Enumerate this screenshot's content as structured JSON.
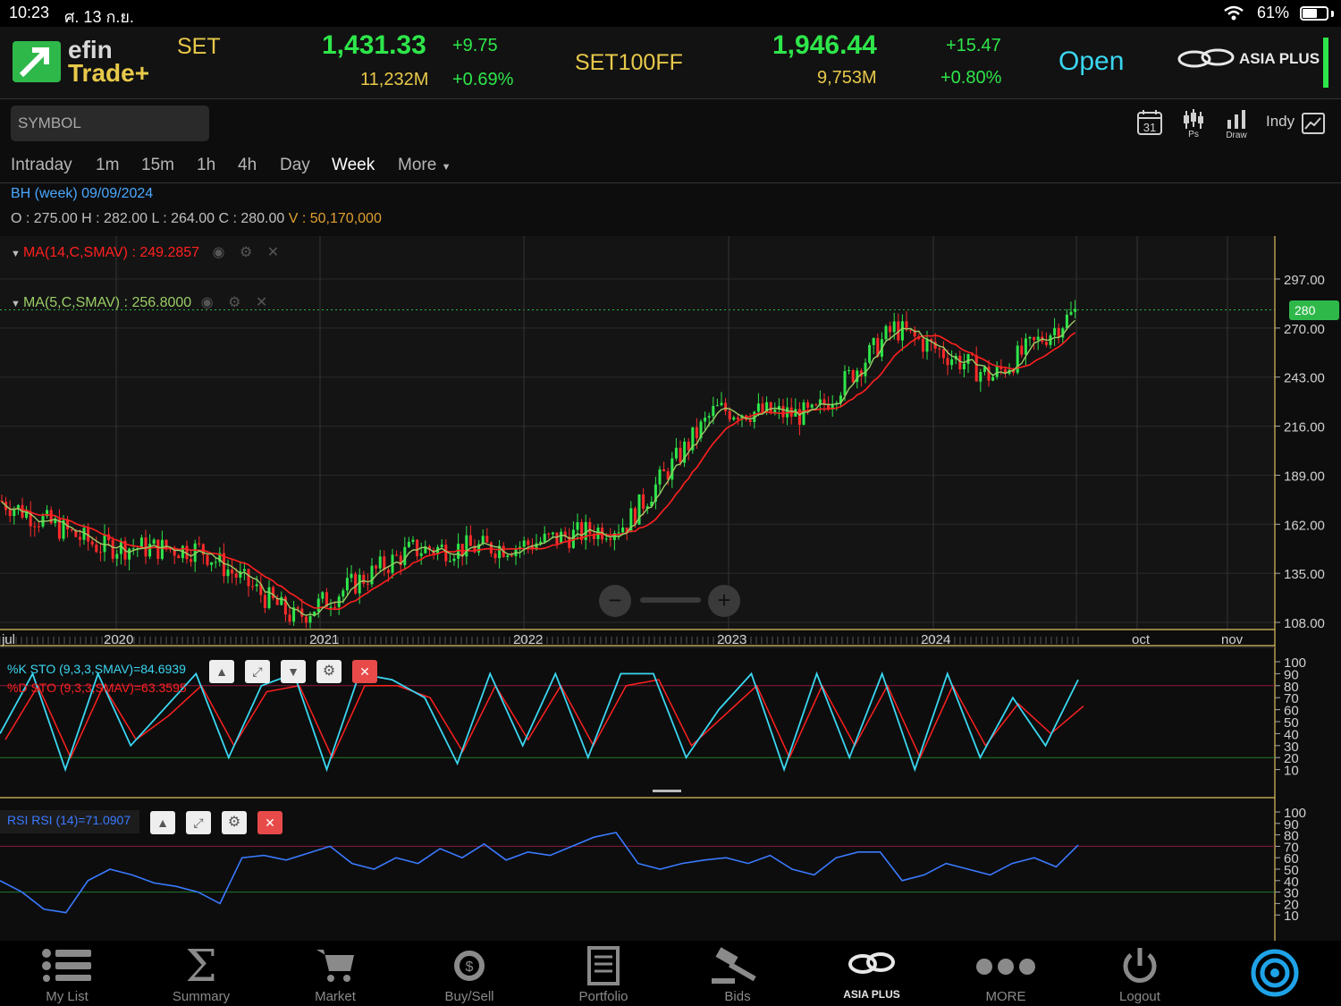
{
  "status_bar": {
    "time": "10:23",
    "date": "ศ. 13 ก.ย.",
    "battery": "61%"
  },
  "header": {
    "logo_top": "efin",
    "logo_bottom": "Trade+",
    "set_label": "SET",
    "set_index": "1,431.33",
    "set_change": "+9.75",
    "set_volume": "11,232M",
    "set_percent": "+0.69%",
    "set100ff_label": "SET100FF",
    "set100ff_index": "1,946.44",
    "set100ff_change": "+15.47",
    "set100ff_volume": "9,753M",
    "set100ff_percent": "+0.80%",
    "market_status": "Open",
    "broker": "ASIA PLUS"
  },
  "toolbar": {
    "symbol_placeholder": "SYMBOL",
    "calendar_day": "31",
    "ps_label": "Ps",
    "draw_label": "Draw",
    "indy_label": "Indy"
  },
  "timeframes": [
    "Intraday",
    "1m",
    "15m",
    "1h",
    "4h",
    "Day",
    "Week",
    "More"
  ],
  "active_timeframe": "Week",
  "info": {
    "title": "BH (week) 09/09/2024",
    "ohlc": "O : 275.00  H : 282.00  L : 264.00  C : 280.00",
    "volume": "V : 50,170,000"
  },
  "chart_data": {
    "type": "line",
    "price_panel": {
      "y_ticks": [
        "297.00",
        "270.00",
        "243.00",
        "216.00",
        "189.00",
        "162.00",
        "135.00",
        "108.00"
      ],
      "ylim": [
        108,
        297
      ],
      "last_price_tag": "280",
      "x_ticks": [
        "jul",
        "2020",
        "2021",
        "2022",
        "2023",
        "2024",
        "oct",
        "nov"
      ],
      "legend": [
        {
          "label": "MA(14,C,SMAV) : 249.2857",
          "color": "#ff2020"
        },
        {
          "label": "MA(5,C,SMAV) : 256.8000",
          "color": "#9acd66"
        }
      ],
      "x": [
        "jul 2019",
        "2020",
        "mid 2020",
        "2021",
        "mid 2021",
        "2022",
        "mid 2022",
        "2023",
        "mid 2023",
        "2024",
        "jul 2024",
        "sep 2024"
      ],
      "close": [
        175,
        150,
        148,
        110,
        148,
        150,
        162,
        225,
        222,
        270,
        243,
        280
      ]
    },
    "stochastic_panel": {
      "y_ticks": [
        "100",
        "90",
        "80",
        "70",
        "60",
        "50",
        "40",
        "30",
        "20",
        "10"
      ],
      "ylim": [
        0,
        100
      ],
      "overbought": 80,
      "oversold": 20,
      "legend": [
        {
          "label": "%K STO (9,3,3,SMAV)=84.6939",
          "color": "#3ad6f0"
        },
        {
          "label": "%D STO (9,3,3,SMAV)=63.3595",
          "color": "#ff2020"
        }
      ],
      "k": [
        40,
        90,
        10,
        90,
        30,
        60,
        90,
        20,
        80,
        90,
        10,
        90,
        85,
        70,
        15,
        90,
        30,
        90,
        20,
        90,
        90,
        20,
        60,
        90,
        10,
        90,
        20,
        90,
        10,
        90,
        20,
        70,
        30,
        85
      ],
      "d": [
        35,
        80,
        20,
        80,
        35,
        55,
        80,
        30,
        75,
        80,
        20,
        80,
        80,
        70,
        25,
        80,
        35,
        80,
        30,
        80,
        85,
        30,
        55,
        80,
        20,
        80,
        30,
        80,
        20,
        80,
        30,
        65,
        40,
        63
      ]
    },
    "rsi_panel": {
      "y_ticks": [
        "100",
        "90",
        "80",
        "70",
        "60",
        "50",
        "40",
        "30",
        "20",
        "10"
      ],
      "ylim": [
        0,
        100
      ],
      "upper": 70,
      "lower": 30,
      "legend": [
        {
          "label": "RSI RSI (14)=71.0907",
          "color": "#3a7aff"
        }
      ],
      "rsi": [
        40,
        30,
        15,
        12,
        40,
        50,
        45,
        38,
        35,
        30,
        20,
        60,
        62,
        58,
        64,
        70,
        55,
        50,
        60,
        55,
        68,
        60,
        72,
        58,
        65,
        62,
        70,
        78,
        82,
        55,
        50,
        55,
        58,
        60,
        55,
        62,
        50,
        45,
        60,
        65,
        65,
        40,
        45,
        55,
        50,
        45,
        55,
        60,
        52,
        71
      ]
    }
  },
  "nav": [
    "My List",
    "Summary",
    "Market",
    "Buy/Sell",
    "Portfolio",
    "Bids",
    "ASIA PLUS",
    "MORE",
    "Logout"
  ],
  "colors": {
    "up": "#2ee64a",
    "down": "#ff2a2a",
    "accent": "#3ad6f0",
    "gold": "#e8c94a"
  }
}
